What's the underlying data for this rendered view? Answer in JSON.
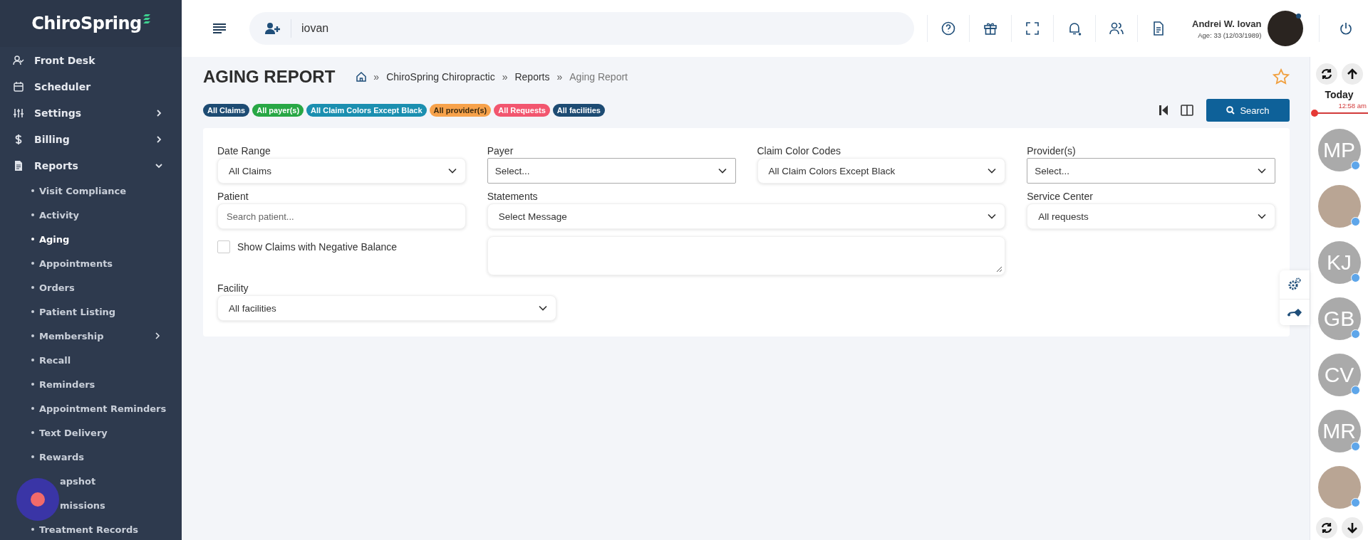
{
  "sidebar": {
    "logo": "ChiroSpring",
    "items": [
      {
        "label": "Front Desk",
        "kind": "link"
      },
      {
        "label": "Scheduler",
        "kind": "link"
      },
      {
        "label": "Settings",
        "kind": "group",
        "expanded": false
      },
      {
        "label": "Billing",
        "kind": "group",
        "expanded": false
      },
      {
        "label": "Reports",
        "kind": "group",
        "expanded": true,
        "children": [
          {
            "label": "Visit Compliance",
            "selected": false
          },
          {
            "label": "Activity",
            "selected": false
          },
          {
            "label": "Aging",
            "selected": true
          },
          {
            "label": "Appointments",
            "selected": false
          },
          {
            "label": "Orders",
            "selected": false
          },
          {
            "label": "Patient Listing",
            "selected": false
          },
          {
            "label": "Membership",
            "selected": false,
            "expandable": true
          },
          {
            "label": "Recall",
            "selected": false
          },
          {
            "label": "Reminders",
            "selected": false
          },
          {
            "label": "Appointment Reminders",
            "selected": false
          },
          {
            "label": "Text Delivery",
            "selected": false
          },
          {
            "label": "Rewards",
            "selected": false
          },
          {
            "label": "apshot",
            "selected": false,
            "covered": true
          },
          {
            "label": "missions",
            "selected": false,
            "covered": true
          },
          {
            "label": "Treatment Records",
            "selected": false
          }
        ]
      }
    ]
  },
  "topbar": {
    "search": {
      "value": "iovan"
    },
    "user": {
      "name": "Andrei W. Iovan",
      "details": "Age: 33 (12/03/1989)"
    }
  },
  "page": {
    "title": "AGING REPORT",
    "breadcrumb_separator": "»",
    "breadcrumb": [
      {
        "label": "ChiroSpring Chiropractic",
        "current": false
      },
      {
        "label": "Reports",
        "current": false
      },
      {
        "label": "Aging Report",
        "current": true
      }
    ],
    "favorite": false,
    "filters": [
      {
        "label": "All Claims",
        "color": "#1d4b73"
      },
      {
        "label": "All payer(s)",
        "color": "#28a745"
      },
      {
        "label": "All Claim Colors Except Black",
        "color": "#1b8fb0"
      },
      {
        "label": "All provider(s)",
        "color": "#f7a24b"
      },
      {
        "label": "All Requests",
        "color": "#f2566f"
      },
      {
        "label": "All facilities",
        "color": "#1d4b73"
      }
    ],
    "search_button": "Search"
  },
  "form": {
    "fields": [
      {
        "kind": "soft-select",
        "label": "Date Range",
        "value": "All Claims"
      },
      {
        "kind": "boxed-select",
        "label": "Payer",
        "value": "Select..."
      },
      {
        "kind": "soft-select",
        "label": "Claim Color Codes",
        "value": "All Claim Colors Except Black"
      },
      {
        "kind": "boxed-select",
        "label": "Provider(s)",
        "value": "Select..."
      },
      {
        "kind": "input",
        "label": "Patient",
        "placeholder": "Search patient..."
      },
      {
        "kind": "soft-select",
        "label": "Statements",
        "value": "Select Message"
      },
      {
        "kind": "soft-select",
        "label": "Service Center",
        "value": "All requests"
      },
      {
        "kind": "checkbox",
        "label": "Show Claims with Negative Balance",
        "checked": false
      },
      {
        "kind": "textarea"
      },
      {
        "kind": "soft-select",
        "label": "Facility",
        "value": "All facilities"
      }
    ]
  },
  "schedule": {
    "today": "Today",
    "time": "12:58 am",
    "people": [
      {
        "kind": "initials",
        "initials": "MP"
      },
      {
        "kind": "photo"
      },
      {
        "kind": "initials",
        "initials": "KJ"
      },
      {
        "kind": "initials",
        "initials": "GB"
      },
      {
        "kind": "initials",
        "initials": "CV"
      },
      {
        "kind": "initials",
        "initials": "MR"
      },
      {
        "kind": "photo"
      }
    ]
  }
}
